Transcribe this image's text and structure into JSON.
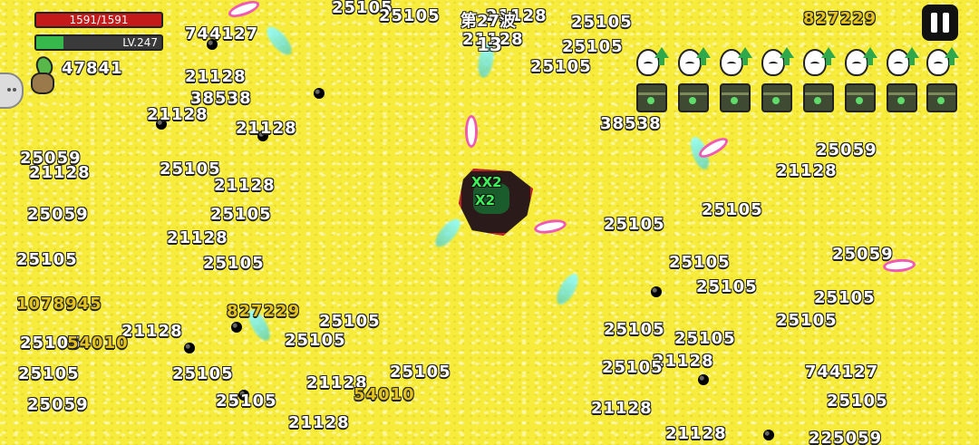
{
  "hud": {
    "hp_text": "1591/1591",
    "hp_fraction": 1.0,
    "level_text": "LV.247",
    "xp_fraction": 0.22,
    "wave_label": "第27波",
    "wave_timer": "13",
    "pause_icon": "pause-icon"
  },
  "player": {
    "combo_lines": [
      "XX2",
      "X2"
    ]
  },
  "upgrades": {
    "items": [
      {
        "icon": "egg-upgrade-icon",
        "arrow": "green-up-arrow"
      },
      {
        "icon": "egg-upgrade-icon",
        "arrow": "green-up-arrow"
      },
      {
        "icon": "egg-upgrade-icon",
        "arrow": "green-up-arrow"
      },
      {
        "icon": "egg-upgrade-icon",
        "arrow": "green-up-arrow"
      },
      {
        "icon": "egg-upgrade-icon",
        "arrow": "green-up-arrow"
      },
      {
        "icon": "egg-upgrade-icon",
        "arrow": "green-up-arrow"
      },
      {
        "icon": "egg-upgrade-icon",
        "arrow": "green-up-arrow"
      },
      {
        "icon": "egg-upgrade-icon",
        "arrow": "green-up-arrow"
      }
    ]
  },
  "damage_numbers": [
    {
      "text": "25105",
      "style": "white"
    },
    {
      "text": "25105",
      "style": "white"
    },
    {
      "text": "25105",
      "style": "white"
    },
    {
      "text": "25105",
      "style": "white"
    },
    {
      "text": "25105",
      "style": "white"
    },
    {
      "text": "21128",
      "style": "white"
    },
    {
      "text": "21128",
      "style": "white"
    },
    {
      "text": "744127",
      "style": "white"
    },
    {
      "text": "47841",
      "style": "white"
    },
    {
      "text": "38538",
      "style": "white"
    },
    {
      "text": "21128",
      "style": "white"
    },
    {
      "text": "21128",
      "style": "white"
    },
    {
      "text": "25105",
      "style": "white"
    },
    {
      "text": "21128",
      "style": "white"
    },
    {
      "text": "25105",
      "style": "white"
    },
    {
      "text": "21128",
      "style": "white"
    },
    {
      "text": "25105",
      "style": "white"
    },
    {
      "text": "21128",
      "style": "white"
    },
    {
      "text": "827229",
      "style": "gold"
    },
    {
      "text": "25105",
      "style": "white"
    },
    {
      "text": "25105",
      "style": "white"
    },
    {
      "text": "21128",
      "style": "white"
    },
    {
      "text": "25105",
      "style": "white"
    },
    {
      "text": "25105",
      "style": "white"
    },
    {
      "text": "21128",
      "style": "white"
    },
    {
      "text": "54010",
      "style": "gold"
    },
    {
      "text": "21128",
      "style": "white"
    },
    {
      "text": "25105",
      "style": "white"
    },
    {
      "text": "38538",
      "style": "white"
    },
    {
      "text": "25105",
      "style": "white"
    },
    {
      "text": "25105",
      "style": "white"
    },
    {
      "text": "25105",
      "style": "white"
    },
    {
      "text": "25105",
      "style": "white"
    },
    {
      "text": "25105",
      "style": "white"
    },
    {
      "text": "25105",
      "style": "white"
    },
    {
      "text": "21128",
      "style": "white"
    },
    {
      "text": "25105",
      "style": "white"
    },
    {
      "text": "21128",
      "style": "white"
    },
    {
      "text": "21128",
      "style": "white"
    },
    {
      "text": "827229",
      "style": "gold"
    },
    {
      "text": "25059",
      "style": "white"
    },
    {
      "text": "21128",
      "style": "white"
    },
    {
      "text": "25059",
      "style": "white"
    },
    {
      "text": "25105",
      "style": "white"
    },
    {
      "text": "744127",
      "style": "white"
    },
    {
      "text": "25105",
      "style": "white"
    },
    {
      "text": "225059",
      "style": "white"
    },
    {
      "text": "25105",
      "style": "white"
    },
    {
      "text": "25059",
      "style": "white"
    },
    {
      "text": "21128",
      "style": "white"
    },
    {
      "text": "25105",
      "style": "white"
    },
    {
      "text": "1078945",
      "style": "gold"
    },
    {
      "text": "25059",
      "style": "white"
    },
    {
      "text": "25105",
      "style": "white"
    },
    {
      "text": "25105",
      "style": "white"
    },
    {
      "text": "25059",
      "style": "white"
    },
    {
      "text": "54010",
      "style": "gold"
    }
  ]
}
